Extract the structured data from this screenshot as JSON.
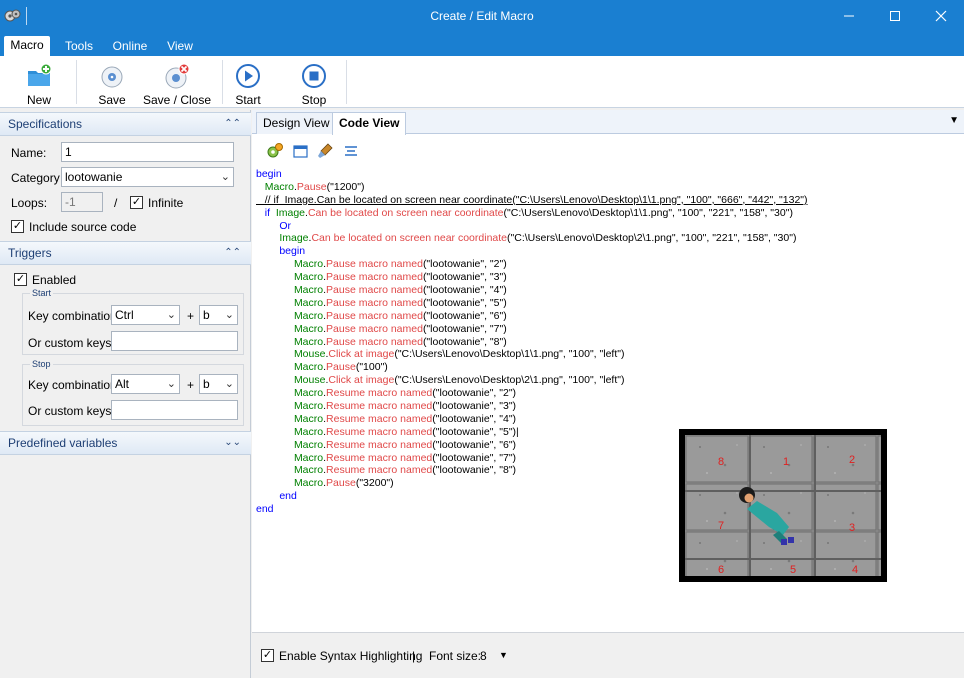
{
  "window": {
    "title": "Create / Edit Macro",
    "buttons": [
      "minimize",
      "maximize",
      "close"
    ]
  },
  "ribbon": {
    "tabs": [
      {
        "label": "Macro",
        "active": true
      },
      {
        "label": "Tools"
      },
      {
        "label": "Online"
      },
      {
        "label": "View"
      }
    ],
    "buttons": [
      {
        "label": "New",
        "icon": "new-folder-icon"
      },
      {
        "label": "Save",
        "icon": "save-disc-icon"
      },
      {
        "label": "Save / Close",
        "icon": "save-close-icon"
      },
      {
        "label": "Start",
        "icon": "play-icon"
      },
      {
        "label": "Stop",
        "icon": "stop-icon"
      }
    ]
  },
  "specifications": {
    "header": "Specifications",
    "name_label": "Name:",
    "name_value": "1",
    "category_label": "Category",
    "category_value": "lootowanie",
    "loops_label": "Loops:",
    "loops_value": "-1",
    "slash": "/",
    "infinite_label": "Infinite",
    "infinite_checked": true,
    "include_source_label": "Include source code",
    "include_source_checked": true
  },
  "triggers": {
    "header": "Triggers",
    "enabled_label": "Enabled",
    "enabled_checked": true,
    "start": {
      "group_label": "Start",
      "key_combination_label": "Key combination:",
      "modifier": "Ctrl",
      "plus": "+",
      "key": "b",
      "custom_keys_label": "Or custom keys:",
      "custom_keys_value": ""
    },
    "stop": {
      "group_label": "Stop",
      "key_combination_label": "Key combination:",
      "modifier": "Alt",
      "plus": "+",
      "key": "b",
      "custom_keys_label": "Or custom keys:",
      "custom_keys_value": ""
    }
  },
  "predefined": {
    "header": "Predefined variables"
  },
  "editor": {
    "tabs": [
      {
        "label": "Design View"
      },
      {
        "label": "Code View",
        "active": true
      }
    ],
    "code_lines": [
      [
        [
          "kw",
          "begin"
        ]
      ],
      [
        [
          "",
          "   "
        ],
        [
          "obj",
          "Macro"
        ],
        [
          "",
          "."
        ],
        [
          "mth",
          "Pause"
        ],
        [
          "str",
          "(\"1200\")"
        ]
      ],
      [
        [
          "cmt",
          "   // if  Image.Can be located on screen near coordinate(\"C:\\Users\\Lenovo\\Desktop\\1\\1.png\", \"100\", \"666\", \"442\", \"132\")"
        ]
      ],
      [
        [
          "kw",
          "   if  "
        ],
        [
          "obj",
          "Image"
        ],
        [
          "",
          "."
        ],
        [
          "mth",
          "Can be located on screen near coordinate"
        ],
        [
          "str",
          "(\"C:\\Users\\Lenovo\\Desktop\\1\\1.png\", \"100\", \"221\", \"158\", \"30\")"
        ]
      ],
      [
        [
          "kw",
          "        Or"
        ]
      ],
      [
        [
          "",
          "        "
        ],
        [
          "obj",
          "Image"
        ],
        [
          "",
          "."
        ],
        [
          "mth",
          "Can be located on screen near coordinate"
        ],
        [
          "str",
          "(\"C:\\Users\\Lenovo\\Desktop\\2\\1.png\", \"100\", \"221\", \"158\", \"30\")"
        ]
      ],
      [
        [
          "kw",
          "        begin"
        ]
      ],
      [
        [
          "",
          "             "
        ],
        [
          "obj",
          "Macro"
        ],
        [
          "",
          "."
        ],
        [
          "mth",
          "Pause macro named"
        ],
        [
          "str",
          "(\"lootowanie\", \"2\")"
        ]
      ],
      [
        [
          "",
          "             "
        ],
        [
          "obj",
          "Macro"
        ],
        [
          "",
          "."
        ],
        [
          "mth",
          "Pause macro named"
        ],
        [
          "str",
          "(\"lootowanie\", \"3\")"
        ]
      ],
      [
        [
          "",
          "             "
        ],
        [
          "obj",
          "Macro"
        ],
        [
          "",
          "."
        ],
        [
          "mth",
          "Pause macro named"
        ],
        [
          "str",
          "(\"lootowanie\", \"4\")"
        ]
      ],
      [
        [
          "",
          "             "
        ],
        [
          "obj",
          "Macro"
        ],
        [
          "",
          "."
        ],
        [
          "mth",
          "Pause macro named"
        ],
        [
          "str",
          "(\"lootowanie\", \"5\")"
        ]
      ],
      [
        [
          "",
          "             "
        ],
        [
          "obj",
          "Macro"
        ],
        [
          "",
          "."
        ],
        [
          "mth",
          "Pause macro named"
        ],
        [
          "str",
          "(\"lootowanie\", \"6\")"
        ]
      ],
      [
        [
          "",
          "             "
        ],
        [
          "obj",
          "Macro"
        ],
        [
          "",
          "."
        ],
        [
          "mth",
          "Pause macro named"
        ],
        [
          "str",
          "(\"lootowanie\", \"7\")"
        ]
      ],
      [
        [
          "",
          "             "
        ],
        [
          "obj",
          "Macro"
        ],
        [
          "",
          "."
        ],
        [
          "mth",
          "Pause macro named"
        ],
        [
          "str",
          "(\"lootowanie\", \"8\")"
        ]
      ],
      [
        [
          "",
          "             "
        ],
        [
          "obj",
          "Mouse"
        ],
        [
          "",
          "."
        ],
        [
          "mth",
          "Click at image"
        ],
        [
          "str",
          "(\"C:\\Users\\Lenovo\\Desktop\\1\\1.png\", \"100\", \"left\")"
        ]
      ],
      [
        [
          "",
          "             "
        ],
        [
          "obj",
          "Macro"
        ],
        [
          "",
          "."
        ],
        [
          "mth",
          "Pause"
        ],
        [
          "str",
          "(\"100\")"
        ]
      ],
      [
        [
          "",
          "             "
        ],
        [
          "obj",
          "Mouse"
        ],
        [
          "",
          "."
        ],
        [
          "mth",
          "Click at image"
        ],
        [
          "str",
          "(\"C:\\Users\\Lenovo\\Desktop\\2\\1.png\", \"100\", \"left\")"
        ]
      ],
      [
        [
          "",
          "             "
        ],
        [
          "obj",
          "Macro"
        ],
        [
          "",
          "."
        ],
        [
          "mth",
          "Resume macro named"
        ],
        [
          "str",
          "(\"lootowanie\", \"2\")"
        ]
      ],
      [
        [
          "",
          "             "
        ],
        [
          "obj",
          "Macro"
        ],
        [
          "",
          "."
        ],
        [
          "mth",
          "Resume macro named"
        ],
        [
          "str",
          "(\"lootowanie\", \"3\")"
        ]
      ],
      [
        [
          "",
          "             "
        ],
        [
          "obj",
          "Macro"
        ],
        [
          "",
          "."
        ],
        [
          "mth",
          "Resume macro named"
        ],
        [
          "str",
          "(\"lootowanie\", \"4\")"
        ]
      ],
      [
        [
          "",
          "             "
        ],
        [
          "obj",
          "Macro"
        ],
        [
          "",
          "."
        ],
        [
          "mth",
          "Resume macro named"
        ],
        [
          "str",
          "(\"lootowanie\", \"5\")|"
        ]
      ],
      [
        [
          "",
          "             "
        ],
        [
          "obj",
          "Macro"
        ],
        [
          "",
          "."
        ],
        [
          "mth",
          "Resume macro named"
        ],
        [
          "str",
          "(\"lootowanie\", \"6\")"
        ]
      ],
      [
        [
          "",
          "             "
        ],
        [
          "obj",
          "Macro"
        ],
        [
          "",
          "."
        ],
        [
          "mth",
          "Resume macro named"
        ],
        [
          "str",
          "(\"lootowanie\", \"7\")"
        ]
      ],
      [
        [
          "",
          "             "
        ],
        [
          "obj",
          "Macro"
        ],
        [
          "",
          "."
        ],
        [
          "mth",
          "Resume macro named"
        ],
        [
          "str",
          "(\"lootowanie\", \"8\")"
        ]
      ],
      [
        [
          "",
          "             "
        ],
        [
          "obj",
          "Macro"
        ],
        [
          "",
          "."
        ],
        [
          "mth",
          "Pause"
        ],
        [
          "str",
          "(\"3200\")"
        ]
      ],
      [
        [
          "kw",
          "        end"
        ]
      ],
      [
        [
          "kw",
          "end"
        ]
      ]
    ],
    "game_preview": {
      "tile_numbers": [
        "8",
        "1",
        "2",
        "7",
        "3",
        "6",
        "5",
        "4"
      ]
    }
  },
  "status": {
    "syntax_label": "Enable Syntax Highlighting",
    "syntax_checked": true,
    "divider": "|",
    "font_size_label": "Font size:",
    "font_size_value": "8"
  },
  "colors": {
    "titlebar": "#1a7fd1",
    "keyword": "#0000ff",
    "object": "#008000",
    "method": "#e04848"
  }
}
